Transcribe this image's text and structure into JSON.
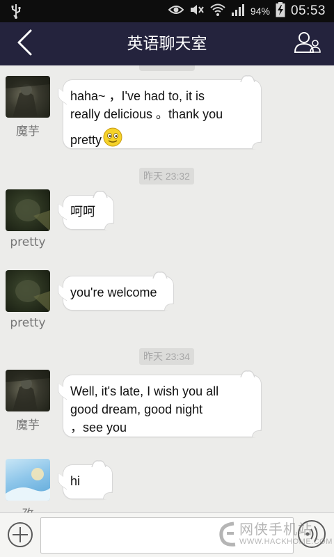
{
  "status_bar": {
    "battery_percent": "94%",
    "time": "05:53",
    "icons": [
      "usb-icon",
      "eye-icon",
      "mute-icon",
      "wifi-icon",
      "signal-icon",
      "battery-charging-icon"
    ]
  },
  "header": {
    "title": "英语聊天室",
    "back_icon": "chevron-left-icon",
    "profile_icon": "group-members-icon"
  },
  "messages": [
    {
      "sender": "魔芋",
      "lines": [
        "haha~  ，I've had to, it is",
        "really delicious 。thank you",
        "pretty"
      ],
      "has_emoji": true,
      "emoji": "😊"
    },
    {
      "sender": "pretty",
      "lines": [
        "呵呵"
      ]
    },
    {
      "sender": "pretty",
      "lines": [
        "you're welcome"
      ]
    },
    {
      "sender": "魔芋",
      "lines": [
        "Well, it's late, I wish you all",
        "good dream, good night",
        "，see you"
      ]
    },
    {
      "sender": "孜",
      "lines": [
        "hi"
      ]
    }
  ],
  "timestamps": [
    "昨天 23:32",
    "昨天 23:34"
  ],
  "input_bar": {
    "value": "",
    "placeholder": "",
    "plus_icon": "plus-circle-icon",
    "voice_icon": "voice-icon"
  },
  "watermark": {
    "cn": "网侠手机站",
    "en": "WWW.HACKHOME.COM"
  },
  "colors": {
    "header_bg": "#24233d",
    "chat_bg": "#ececea",
    "bubble_bg": "#ffffff",
    "status_bg": "#0d0d0d"
  }
}
